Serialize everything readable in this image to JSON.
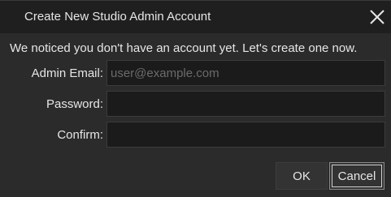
{
  "window": {
    "title": "Create New Studio Admin Account",
    "close_icon": "close-icon"
  },
  "message": "We noticed you don't have an account yet. Let's create one now.",
  "form": {
    "email_label": "Admin Email:",
    "email_placeholder": "user@example.com",
    "email_value": "",
    "password_label": "Password:",
    "password_value": "",
    "confirm_label": "Confirm:",
    "confirm_value": ""
  },
  "buttons": {
    "ok_label": "OK",
    "cancel_label": "Cancel"
  },
  "colors": {
    "background": "#2b2b2b",
    "titlebar": "#1f1f1f",
    "field_background": "#1b1b1b",
    "text": "#e6e6e6",
    "placeholder": "#6b6b6b"
  }
}
